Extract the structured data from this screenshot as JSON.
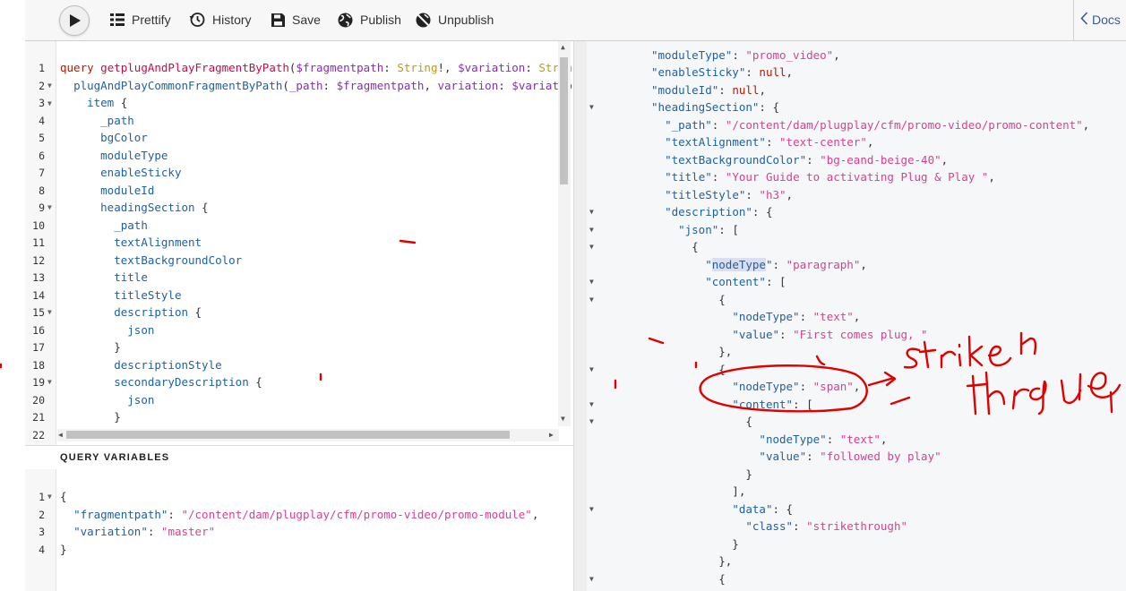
{
  "toolbar": {
    "prettify": "Prettify",
    "history": "History",
    "save": "Save",
    "publish": "Publish",
    "unpublish": "Unpublish",
    "docs": "Docs"
  },
  "query_editor": {
    "line_numbers": [
      "1",
      "2",
      "3",
      "4",
      "5",
      "6",
      "7",
      "8",
      "9",
      "10",
      "11",
      "12",
      "13",
      "14",
      "15",
      "16",
      "17",
      "18",
      "19",
      "20",
      "21",
      "22"
    ],
    "lines": {
      "l1_kw": "query",
      "l1_name": "getplugAndPlayFragmentByPath",
      "l1_v1": "$fragmentpath",
      "l1_t1": "String",
      "l1_v2": "$variation",
      "l1_t2": "String!",
      "l2_field": "plugAndPlayCommonFragmentByPath",
      "l2_arg1": "_path",
      "l2_v1": "$fragmentpath",
      "l2_arg2": "variation",
      "l2_v2": "$variation",
      "l3": "item",
      "l4": "_path",
      "l5": "bgColor",
      "l6": "moduleType",
      "l7": "enableSticky",
      "l8": "moduleId",
      "l9": "headingSection",
      "l10": "_path",
      "l11": "textAlignment",
      "l12": "textBackgroundColor",
      "l13": "title",
      "l14": "titleStyle",
      "l15": "description",
      "l16": "json",
      "l18": "descriptionStyle",
      "l19": "secondaryDescription",
      "l20": "json"
    }
  },
  "query_variables": {
    "header": "QUERY VARIABLES",
    "line_numbers": [
      "1",
      "2",
      "3",
      "4"
    ],
    "fragmentpath_key": "\"fragmentpath\"",
    "fragmentpath_value": "\"/content/dam/plugplay/cfm/promo-video/promo-module\"",
    "variation_key": "\"variation\"",
    "variation_value": "\"master\""
  },
  "result": {
    "moduleType_key": "\"moduleType\"",
    "moduleType_val": "\"promo_video\"",
    "enableSticky_key": "\"enableSticky\"",
    "moduleId_key": "\"moduleId\"",
    "null": "null",
    "headingSection_key": "\"headingSection\"",
    "path_key": "\"_path\"",
    "path_val": "\"/content/dam/plugplay/cfm/promo-video/promo-content\"",
    "textAlignment_key": "\"textAlignment\"",
    "textAlignment_val": "\"text-center\"",
    "textBackgroundColor_key": "\"textBackgroundColor\"",
    "textBackgroundColor_val": "\"bg-eand-beige-40\"",
    "title_key": "\"title\"",
    "title_val": "\"Your Guide to activating Plug & Play \"",
    "titleStyle_key": "\"titleStyle\"",
    "titleStyle_val": "\"h3\"",
    "description_key": "\"description\"",
    "json_key": "\"json\"",
    "nodeType_word": "nodeType",
    "nodeType_key": "\"nodeType\"",
    "paragraph_val": "\"paragraph\"",
    "content_key": "\"content\"",
    "text_val": "\"text\"",
    "value_key": "\"value\"",
    "first_val": "\"First comes plug, \"",
    "span_val": "\"span\"",
    "followed_val": "\"followed by play\"",
    "data_key": "\"data\"",
    "class_key": "\"class\"",
    "strikethrough_val": "\"strikethrough\""
  },
  "annotation": {
    "handwritten_text": "strike through"
  }
}
